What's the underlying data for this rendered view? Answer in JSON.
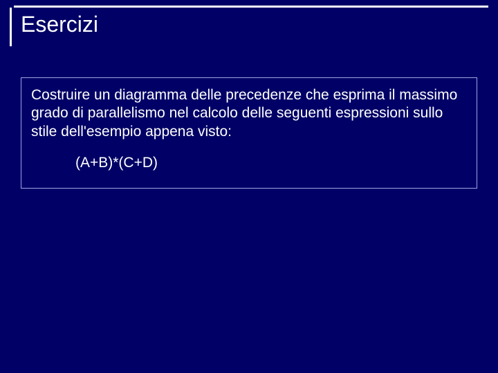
{
  "slide": {
    "title": "Esercizi",
    "body": "Costruire un diagramma delle precedenze che esprima il massimo grado di parallelismo nel calcolo delle seguenti espressioni sullo stile dell'esempio appena visto:",
    "expression": "(A+B)*(C+D)"
  }
}
